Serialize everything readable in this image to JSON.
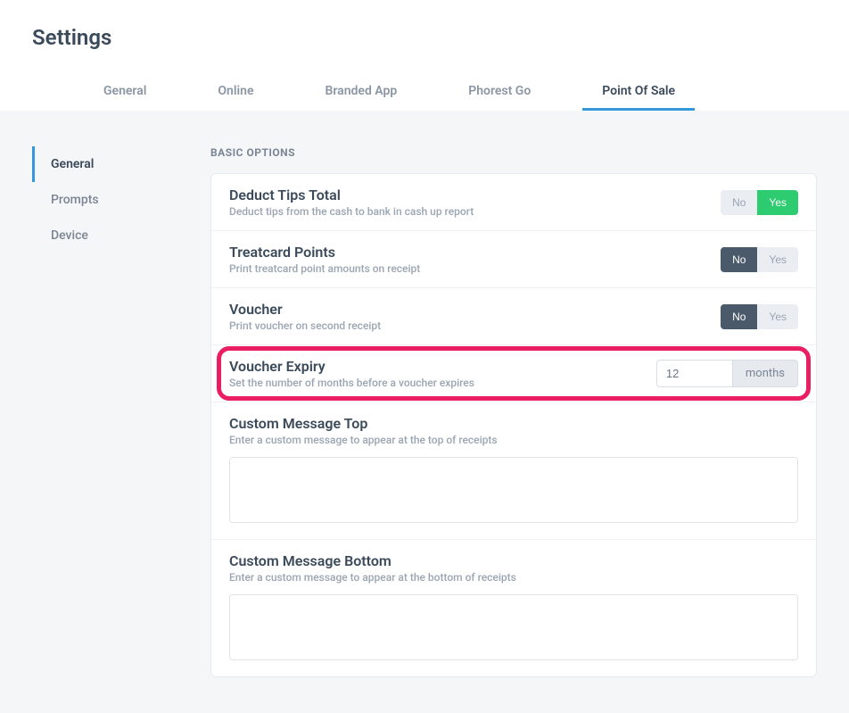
{
  "page_title": "Settings",
  "top_tabs": {
    "general": "General",
    "online": "Online",
    "branded_app": "Branded App",
    "phorest_go": "Phorest Go",
    "point_of_sale": "Point Of Sale"
  },
  "sidebar": {
    "general": "General",
    "prompts": "Prompts",
    "device": "Device"
  },
  "section_header": "BASIC OPTIONS",
  "rows": {
    "deduct_tips": {
      "title": "Deduct Tips Total",
      "desc": "Deduct tips from the cash to bank in cash up report",
      "no": "No",
      "yes": "Yes"
    },
    "treatcard": {
      "title": "Treatcard Points",
      "desc": "Print treatcard point amounts on receipt",
      "no": "No",
      "yes": "Yes"
    },
    "voucher": {
      "title": "Voucher",
      "desc": "Print voucher on second receipt",
      "no": "No",
      "yes": "Yes"
    },
    "voucher_expiry": {
      "title": "Voucher Expiry",
      "desc": "Set the number of months before a voucher expires",
      "value": "12",
      "unit": "months"
    },
    "custom_top": {
      "title": "Custom Message Top",
      "desc": "Enter a custom message to appear at the top of receipts"
    },
    "custom_bottom": {
      "title": "Custom Message Bottom",
      "desc": "Enter a custom message to appear at the bottom of receipts"
    }
  }
}
